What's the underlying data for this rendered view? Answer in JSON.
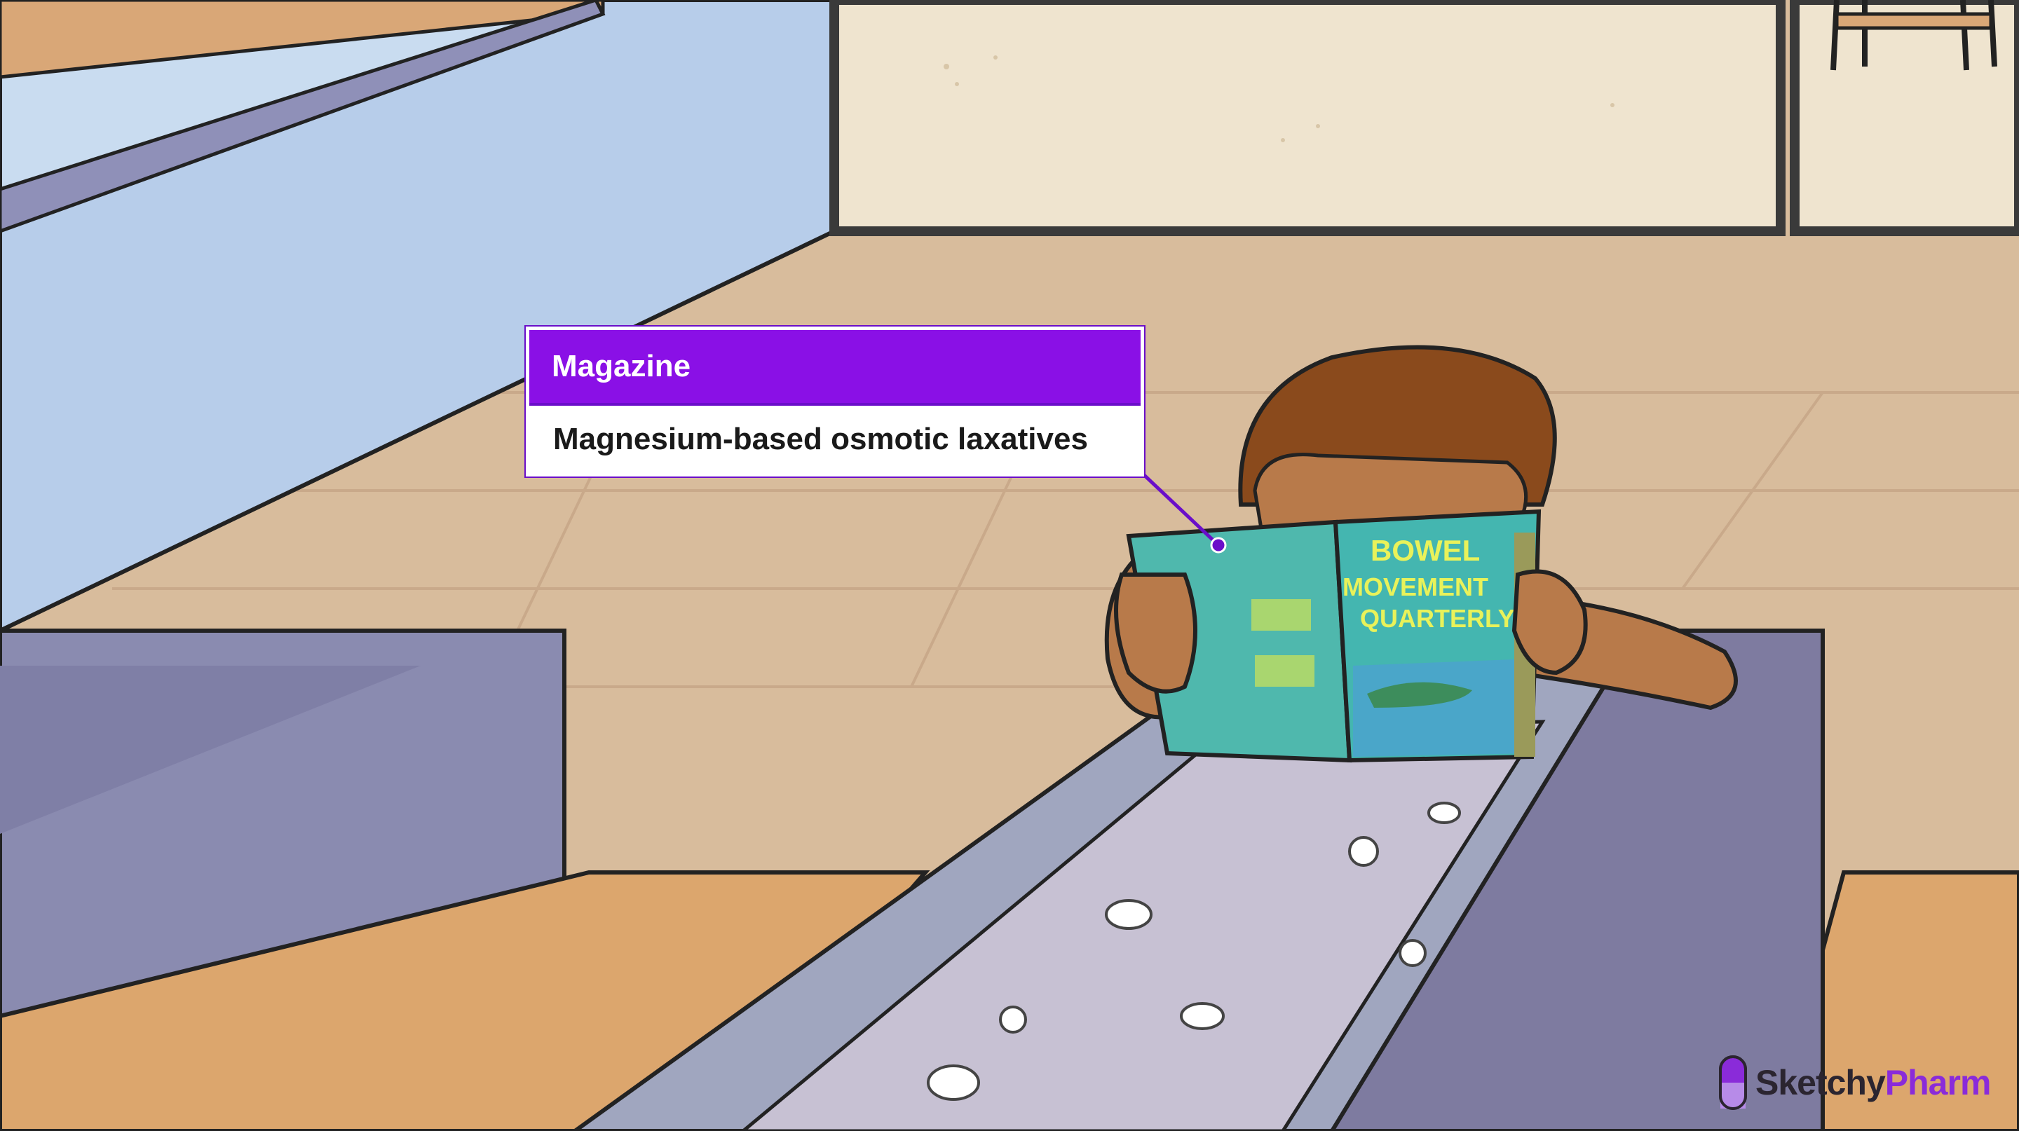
{
  "callout": {
    "title": "Magazine",
    "description": "Magnesium-based osmotic laxatives"
  },
  "magazine": {
    "cover_lines": [
      "BOWEL",
      "MOVEMENT",
      "QUARTERLY"
    ]
  },
  "brand": {
    "name_part1": "Sketchy",
    "name_part2": "Pharm"
  },
  "colors": {
    "callout_header": "#8a10e6",
    "brand_accent": "#8a2bd9",
    "magazine_cover": "#3fb5ad"
  }
}
